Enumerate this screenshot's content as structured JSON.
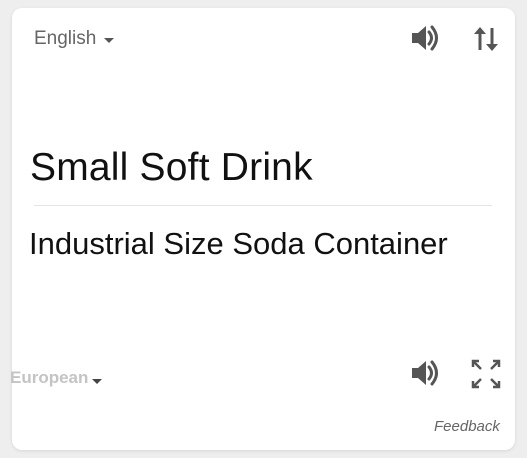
{
  "source": {
    "language": "English",
    "text": "Small Soft Drink"
  },
  "target": {
    "language": "European",
    "text": "Industrial Size Soda Container"
  },
  "icons": {
    "source_listen": "speaker-icon",
    "swap": "swap-arrows-icon",
    "target_listen": "speaker-icon",
    "expand": "expand-icon",
    "dropdown": "caret-down-icon"
  },
  "footer": {
    "feedback_label": "Feedback"
  },
  "colors": {
    "icon": "#555555",
    "source_language_text": "#666666",
    "target_language_text": "#c4c4c4",
    "main_text": "#111111"
  }
}
